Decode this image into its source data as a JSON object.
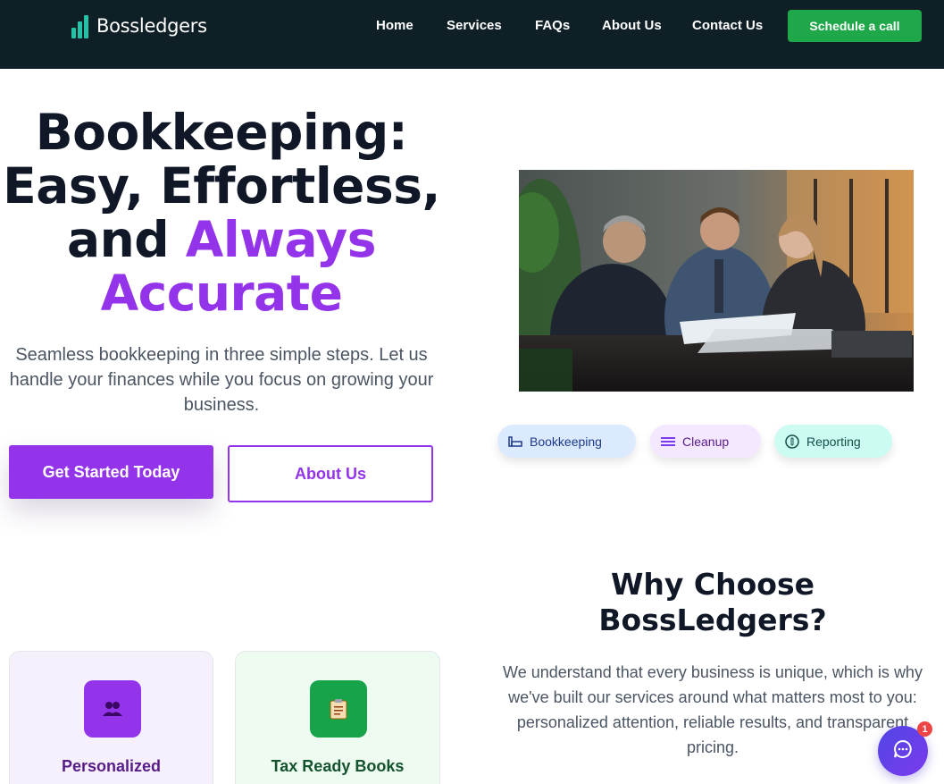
{
  "nav": {
    "brand": "Bossledgers",
    "links": [
      "Home",
      "Services",
      "FAQs",
      "About Us",
      "Contact Us"
    ],
    "cta": "Schedule a call"
  },
  "hero": {
    "title_line1": "Bookkeeping:",
    "title_line2": "Easy, Effortless,",
    "title_line3_plain": "and ",
    "title_line3_accent": "Always",
    "title_line4_accent": "Accurate",
    "subtitle": "Seamless bookkeeping in three simple steps. Let us handle your finances while you focus on growing your business.",
    "primary_button": "Get Started Today",
    "secondary_button": "About Us"
  },
  "pills": [
    {
      "label": "Bookkeeping",
      "icon": "ledger-icon",
      "bg": "#dbeafe",
      "color": "#1e3a8a"
    },
    {
      "label": "Cleanup",
      "icon": "list-lines-icon",
      "bg": "#f3e8ff",
      "color": "#581c87"
    },
    {
      "label": "Reporting",
      "icon": "coin-icon",
      "bg": "#ccfbf1",
      "color": "#134e4a"
    }
  ],
  "why": {
    "title_line1": "Why Choose",
    "title_line2": "BossLedgers?",
    "text": "We understand that every business is unique, which is why we've built our services around what matters most to you: personalized attention, reliable results, and transparent pricing."
  },
  "cards": [
    {
      "label": "Personalized",
      "icon": "people-icon",
      "icon_bg": "#9333ea",
      "bg": "#f6f0fd",
      "color": "#581c87"
    },
    {
      "label": "Tax Ready Books",
      "icon": "clipboard-icon",
      "icon_bg": "#16a34a",
      "bg": "#edfbf1",
      "color": "#14532d"
    }
  ],
  "chat": {
    "badge": "1"
  },
  "colors": {
    "nav_bg": "#0f1f26",
    "accent": "#9333ea",
    "cta_green": "#1fa84a"
  }
}
